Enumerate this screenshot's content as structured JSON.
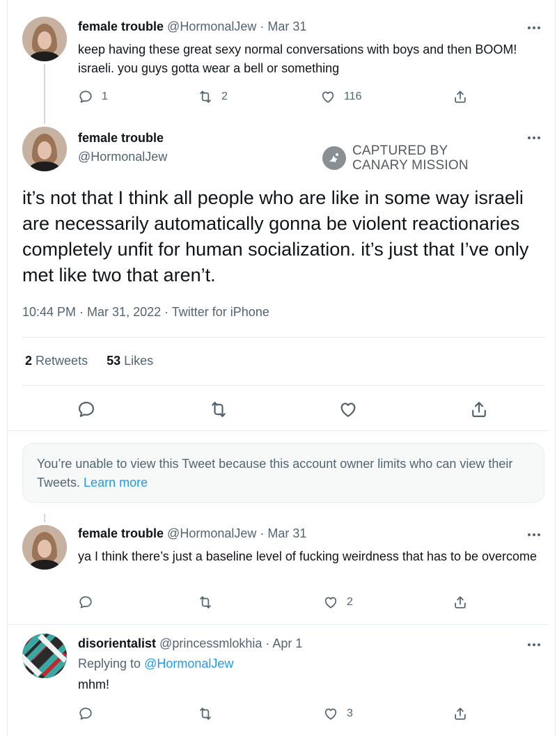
{
  "tweet1": {
    "name": "female trouble",
    "handle": "@HormonalJew",
    "sep": "·",
    "date": "Mar 31",
    "text": "keep having these great sexy normal conversations with boys and then BOOM! israeli. you guys gotta wear a bell or something",
    "replies": "1",
    "retweets": "2",
    "likes": "116"
  },
  "main_tweet": {
    "name": "female trouble",
    "handle": "@HormonalJew",
    "text": "it’s not that I think all people who are like in some way israeli are necessarily automatically gonna be violent reactionaries completely unfit for human socialization. it’s just that I’ve only met like two that aren’t.",
    "meta": "10:44 PM · Mar 31, 2022 · Twitter for iPhone",
    "retweets_count": "2",
    "retweets_label": "Retweets",
    "likes_count": "53",
    "likes_label": "Likes"
  },
  "watermark": {
    "line1": "CAPTURED BY",
    "line2": "CANARY MISSION"
  },
  "restricted_notice": {
    "text": "You’re unable to view this Tweet because this account owner limits who can view their Tweets.",
    "link": "Learn more"
  },
  "tweet3": {
    "name": "female trouble",
    "handle": "@HormonalJew",
    "sep": "·",
    "date": "Mar 31",
    "text": "ya I think there’s just a baseline level of fucking weirdness that has to be overcome",
    "likes": "2"
  },
  "tweet4": {
    "name": "disorientalist",
    "handle": "@princessmlokhia",
    "sep": "·",
    "date": "Apr 1",
    "replying_prefix": "Replying to",
    "replying_to": "@HormonalJew",
    "text": "mhm!",
    "likes": "3"
  },
  "colors": {
    "text": "#0f1419",
    "muted": "#536471",
    "link": "#1d9bf0",
    "border": "#e6ecf0",
    "notice_bg": "#f7f9f9"
  },
  "icons": [
    "reply-icon",
    "retweet-icon",
    "like-icon",
    "share-icon",
    "more-icon",
    "canary-mission-logo-icon"
  ]
}
